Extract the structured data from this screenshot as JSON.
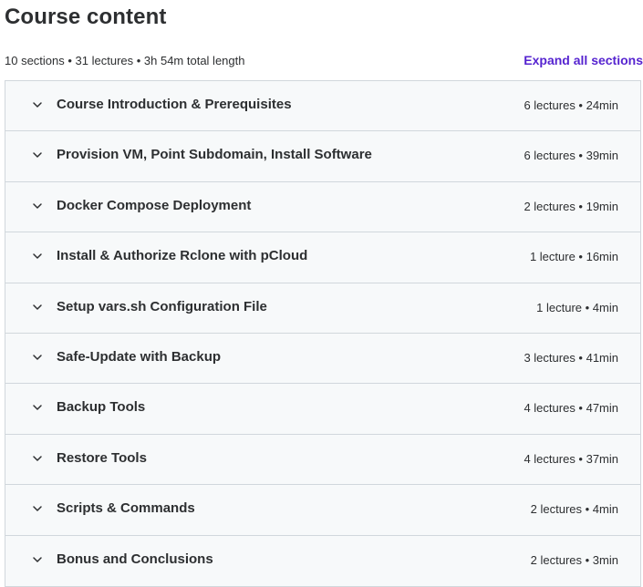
{
  "header": {
    "title": "Course content",
    "summary": "10 sections • 31 lectures • 3h 54m total length",
    "expand_label": "Expand all sections"
  },
  "sections": [
    {
      "title": "Course Introduction & Prerequisites",
      "meta": "6 lectures • 24min"
    },
    {
      "title": "Provision VM, Point Subdomain, Install Software",
      "meta": "6 lectures • 39min"
    },
    {
      "title": "Docker Compose Deployment",
      "meta": "2 lectures • 19min"
    },
    {
      "title": "Install & Authorize Rclone with pCloud",
      "meta": "1 lecture • 16min"
    },
    {
      "title": "Setup vars.sh Configuration File",
      "meta": "1 lecture • 4min"
    },
    {
      "title": "Safe-Update with Backup",
      "meta": "3 lectures • 41min"
    },
    {
      "title": "Backup Tools",
      "meta": "4 lectures • 47min"
    },
    {
      "title": "Restore Tools",
      "meta": "4 lectures • 37min"
    },
    {
      "title": "Scripts & Commands",
      "meta": "2 lectures • 4min"
    },
    {
      "title": "Bonus and Conclusions",
      "meta": "2 lectures • 3min"
    }
  ],
  "icons": {
    "section_toggle": "chevron-down-icon"
  },
  "colors": {
    "link": "#5624d0",
    "text": "#2d2f31",
    "section_bg": "#f7f9fa",
    "border": "#d1d7dc"
  }
}
